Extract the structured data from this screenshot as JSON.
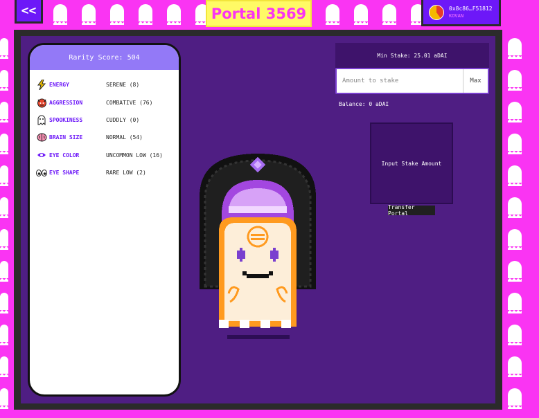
{
  "header": {
    "back_label": "<<",
    "title": "Portal 3569",
    "wallet_address": "0x8c86…F51812",
    "wallet_network": "KOVAN"
  },
  "traits": {
    "rarity_label": "Rarity Score: 504",
    "items": [
      {
        "name": "ENERGY",
        "value": "SERENE (8)",
        "icon": "lightning-icon"
      },
      {
        "name": "AGGRESSION",
        "value": "COMBATIVE (76)",
        "icon": "demon-face-icon"
      },
      {
        "name": "SPOOKINESS",
        "value": "CUDDLY (0)",
        "icon": "ghost-icon"
      },
      {
        "name": "BRAIN SIZE",
        "value": "NORMAL (54)",
        "icon": "brain-icon"
      },
      {
        "name": "EYE COLOR",
        "value": "UNCOMMON LOW (16)",
        "icon": "eye-icon"
      },
      {
        "name": "EYE SHAPE",
        "value": "RARE LOW (2)",
        "icon": "eyes-icon"
      }
    ]
  },
  "stake": {
    "min_stake_label": "Min Stake: 25.01 aDAI",
    "input_placeholder": "Amount to stake",
    "input_value": "",
    "max_label": "Max",
    "balance_label": "Balance: 0 aDAI",
    "action_label": "Input Stake Amount",
    "transfer_label": "Transfer Portal"
  },
  "colors": {
    "background": "#fa34f3",
    "accent": "#6d18f8",
    "panel": "#4f1e83",
    "rarity_header": "#9379f7",
    "title_bg": "#fffa65"
  }
}
